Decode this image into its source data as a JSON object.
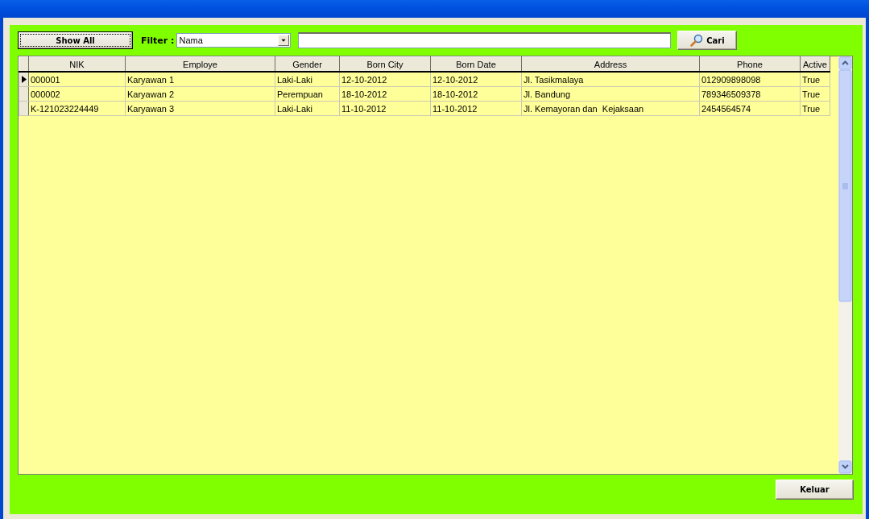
{
  "toolbar": {
    "show_all_button": "Show All",
    "filter_label": "Filter :",
    "filter_value": "Nama",
    "search_button": "Cari"
  },
  "table": {
    "columns": [
      "NIK",
      "Employe",
      "Gender",
      "Born City",
      "Born Date",
      "Address",
      "Phone",
      "Active"
    ],
    "rows": [
      {
        "selected": true,
        "cells": [
          "000001",
          "Karyawan 1",
          "Laki-Laki",
          "12-10-2012",
          "12-10-2012",
          "Jl. Tasikmalaya",
          "012909898098",
          "True"
        ]
      },
      {
        "selected": false,
        "cells": [
          "000002",
          "Karyawan 2",
          "Perempuan",
          "18-10-2012",
          "18-10-2012",
          "Jl. Bandung",
          "789346509378",
          "True"
        ]
      },
      {
        "selected": false,
        "cells": [
          "K-121023224449",
          "Karyawan 3",
          "Laki-Laki",
          "11-10-2012",
          "11-10-2012",
          "Jl. Kemayoran dan  Kejaksaan",
          "2454564574",
          "True"
        ]
      }
    ]
  },
  "exit_button": "Keluar"
}
